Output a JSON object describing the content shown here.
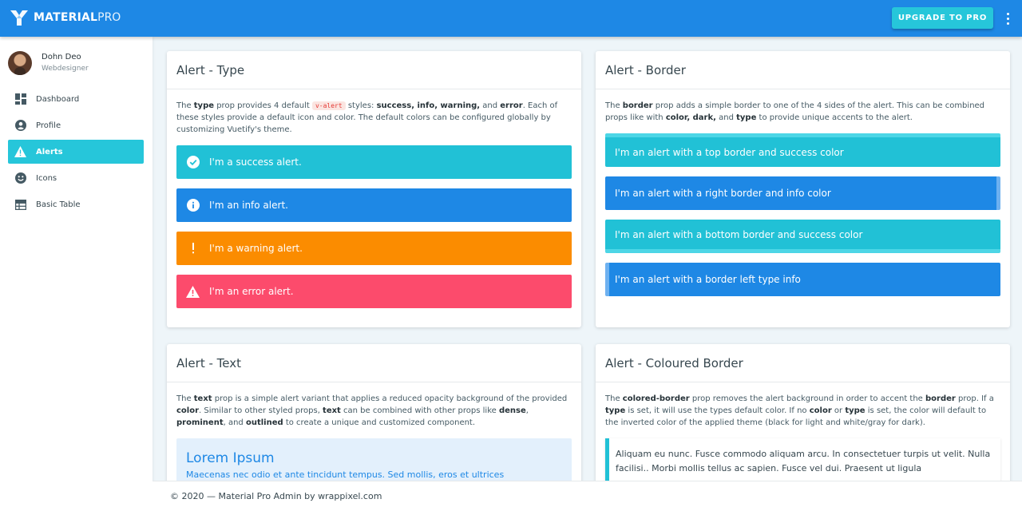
{
  "header": {
    "brand_main": "MATERIAL",
    "brand_light": "PRO",
    "upgrade_label": "UPGRADE TO PRO"
  },
  "user": {
    "name": "Dohn Deo",
    "role": "Webdesigner"
  },
  "sidebar": {
    "items": [
      {
        "label": "Dashboard",
        "icon": "dashboard-icon"
      },
      {
        "label": "Profile",
        "icon": "account-icon"
      },
      {
        "label": "Alerts",
        "icon": "alert-icon",
        "active": true
      },
      {
        "label": "Icons",
        "icon": "emoticon-icon"
      },
      {
        "label": "Basic Table",
        "icon": "table-icon"
      }
    ]
  },
  "cards": {
    "type": {
      "title": "Alert - Type",
      "desc": [
        "The ",
        "type",
        " prop provides 4 default ",
        "v-alert",
        " styles: ",
        "success, info, warning,",
        " and ",
        "error",
        ". Each of these styles provide a default icon and color. The default colors can be configured globally by customizing Vuetify's theme."
      ],
      "alerts": [
        "I'm a success alert.",
        "I'm an info alert.",
        "I'm a warning alert.",
        "I'm an error alert."
      ]
    },
    "border": {
      "title": "Alert - Border",
      "desc": [
        "The ",
        "border",
        " prop adds a simple border to one of the 4 sides of the alert. This can be combined props like with ",
        "color, dark,",
        " and ",
        "type",
        " to provide unique accents to the alert."
      ],
      "alerts": [
        "I'm an alert with a top border and success color",
        "I'm an alert with a right border and info color",
        "I'm an alert with a bottom border and success color",
        "I'm an alert with a border left type info"
      ]
    },
    "text": {
      "title": "Alert - Text",
      "desc": [
        "The ",
        "text",
        " prop is a simple alert variant that applies a reduced opacity background of the provided ",
        "color",
        ". Similar to other styled props, ",
        "text",
        " can be combined with other props like ",
        "dense",
        ", ",
        "prominent",
        ", and ",
        "outlined",
        " to create a unique and customized component."
      ],
      "alert_heading": "Lorem Ipsum",
      "alert_text": "Maecenas nec odio et ante tincidunt tempus. Sed mollis, eros et ultrices"
    },
    "colored": {
      "title": "Alert - Coloured Border",
      "desc": [
        "The ",
        "colored-border",
        " prop removes the alert background in order to accent the ",
        "border",
        " prop. If a ",
        "type",
        " is set, it will use the types default color. If no ",
        "color",
        " or ",
        "type",
        " is set, the color will default to the inverted color of the applied theme (black for light and white/gray for dark)."
      ],
      "alert_text": "Aliquam eu nunc. Fusce commodo aliquam arcu. In consectetuer turpis ut velit. Nulla facilisi.. Morbi mollis tellus ac sapien. Fusce vel dui. Praesent ut ligula"
    }
  },
  "footer": {
    "text": "© 2020 — Material Pro Admin by wrappixel.com"
  },
  "colors": {
    "primary": "#1e88e5",
    "success": "#21c1d6",
    "warning": "#fb8c00",
    "error": "#fc4b6c"
  }
}
